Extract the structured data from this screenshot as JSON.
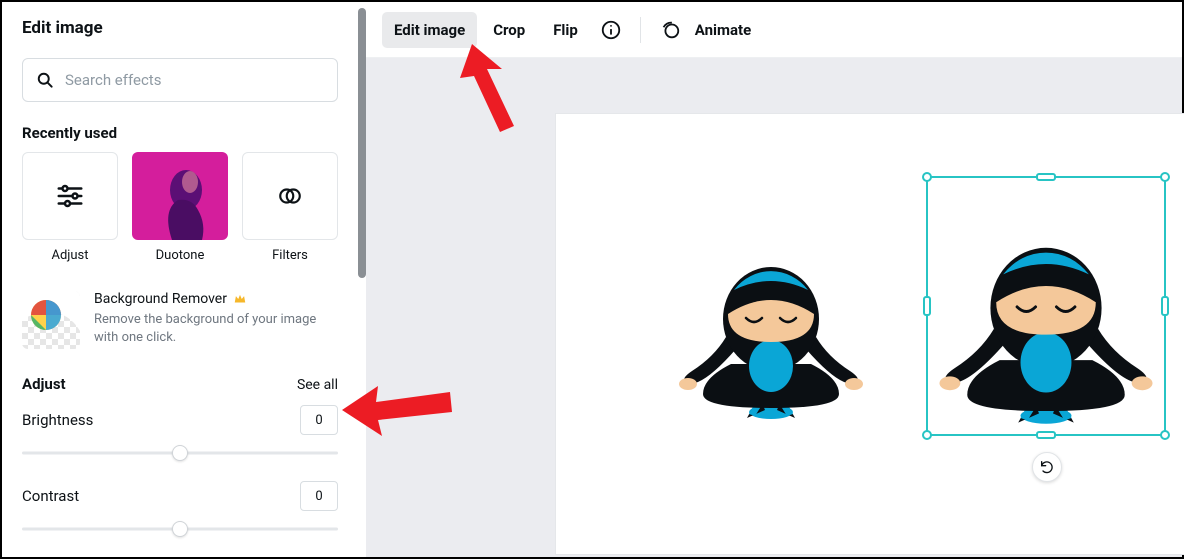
{
  "sidebar": {
    "title": "Edit image",
    "search_placeholder": "Search effects",
    "recently_used_heading": "Recently used",
    "tiles": [
      {
        "label": "Adjust"
      },
      {
        "label": "Duotone"
      },
      {
        "label": "Filters"
      }
    ],
    "bg_remover": {
      "title": "Background Remover",
      "desc": "Remove the background of your image with one click."
    },
    "adjust": {
      "heading": "Adjust",
      "see_all": "See all",
      "items": [
        {
          "label": "Brightness",
          "value": "0"
        },
        {
          "label": "Contrast",
          "value": "0"
        }
      ]
    }
  },
  "toolbar": {
    "edit_image": "Edit image",
    "crop": "Crop",
    "flip": "Flip",
    "animate": "Animate"
  }
}
